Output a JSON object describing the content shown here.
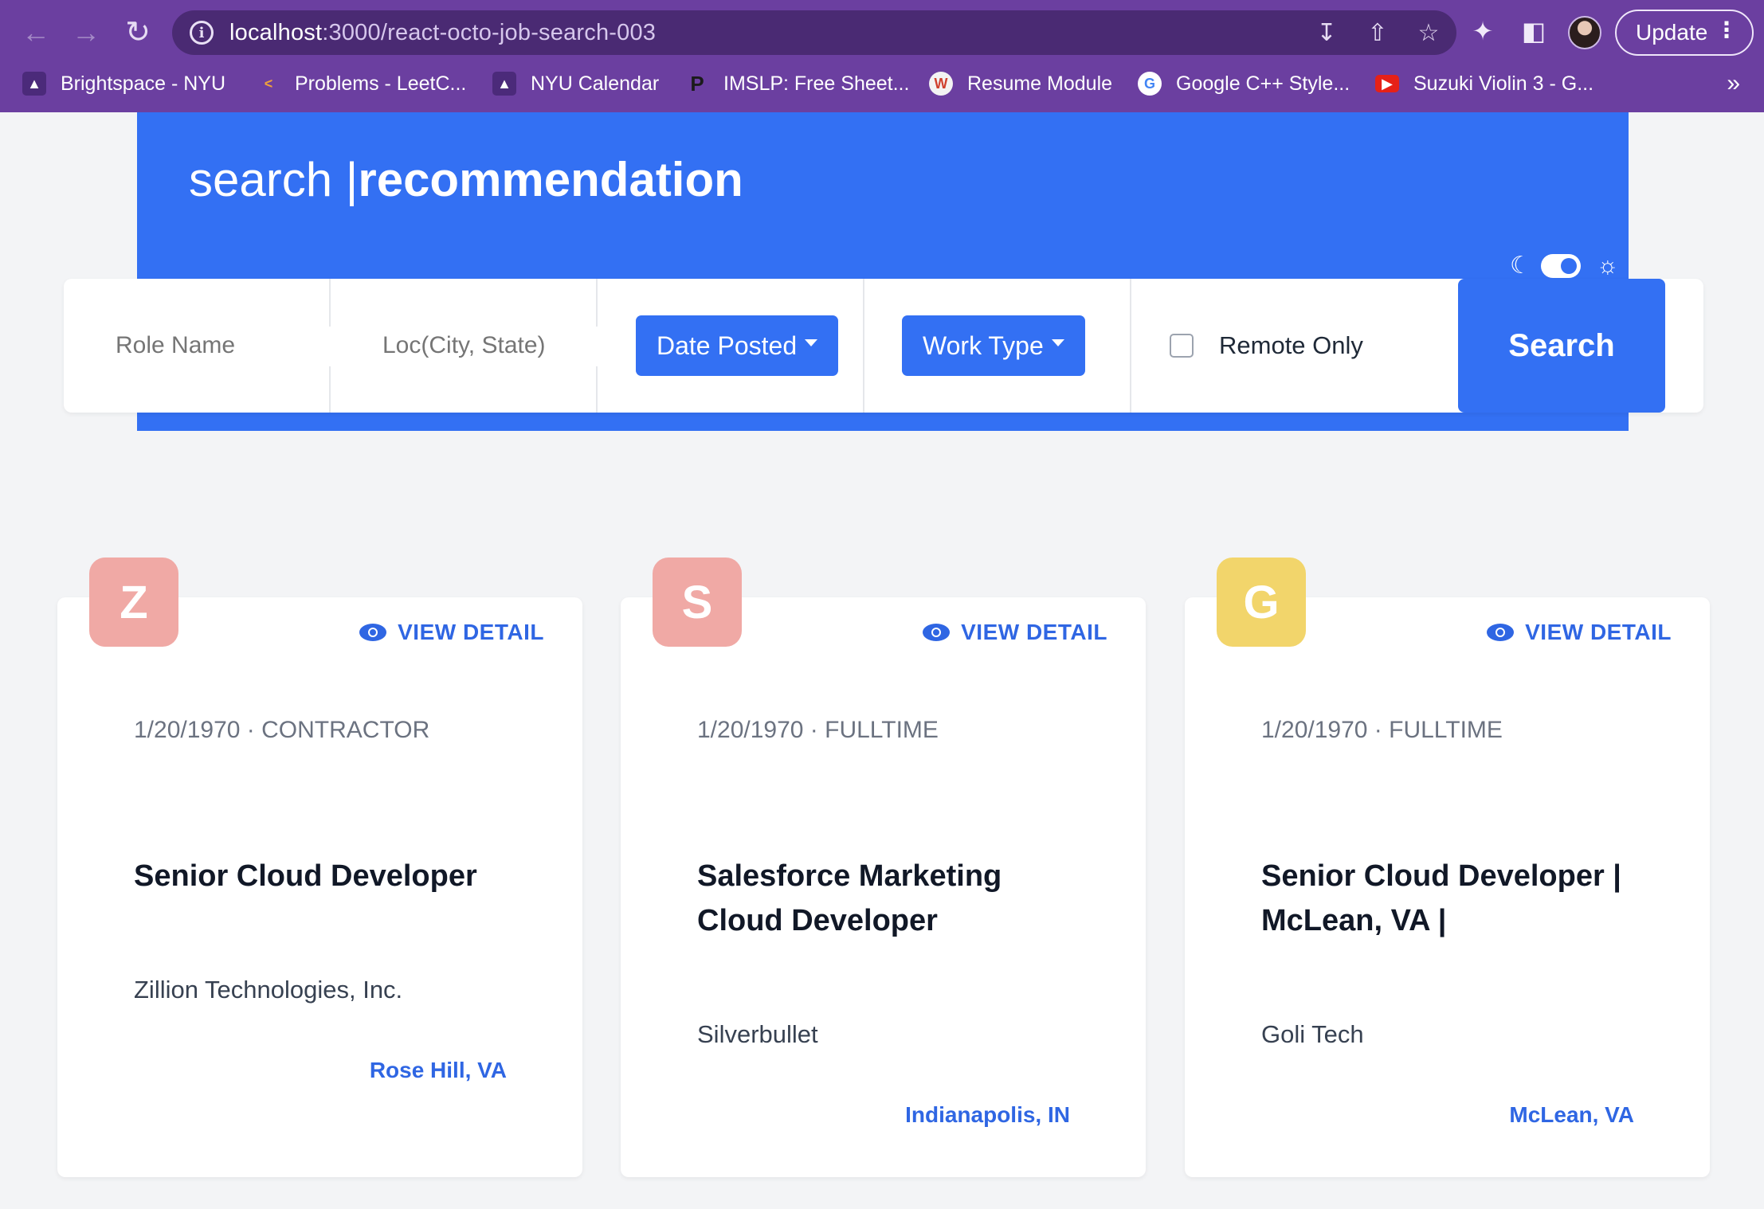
{
  "browser": {
    "url_host": "localhost",
    "url_path": ":3000/react-octo-job-search-003",
    "update_label": "Update",
    "bookmarks": [
      {
        "label": "Brightspace - NYU",
        "icon": "torch-icon"
      },
      {
        "label": "Problems - LeetC...",
        "icon": "leetcode-icon"
      },
      {
        "label": "NYU Calendar",
        "icon": "torch-icon"
      },
      {
        "label": "IMSLP: Free Sheet...",
        "icon": "imslp-icon"
      },
      {
        "label": "Resume Module",
        "icon": "resume-icon"
      },
      {
        "label": "Google C++ Style...",
        "icon": "google-icon"
      },
      {
        "label": "Suzuki Violin 3 - G...",
        "icon": "youtube-icon"
      }
    ],
    "more_label": "»"
  },
  "hero": {
    "title_light": "search |",
    "title_bold": "recommendation"
  },
  "search": {
    "role_placeholder": "Role Name",
    "location_placeholder": "Loc(City, State)",
    "date_posted_label": "Date Posted",
    "work_type_label": "Work Type",
    "remote_only_label": "Remote Only",
    "remote_only_checked": false,
    "search_label": "Search"
  },
  "theme": {
    "dark_icon": "moon-icon",
    "light_icon": "sun-icon",
    "toggle_on": true
  },
  "cards": [
    {
      "logo_letter": "Z",
      "logo_color": "#f0a9a5",
      "view_label": "VIEW DETAIL",
      "meta": "1/20/1970 · CONTRACTOR",
      "title": "Senior Cloud Developer",
      "company": "Zillion Technologies, Inc.",
      "location": "Rose Hill, VA"
    },
    {
      "logo_letter": "S",
      "logo_color": "#f0a9a5",
      "view_label": "VIEW DETAIL",
      "meta": "1/20/1970 · FULLTIME",
      "title": "Salesforce Marketing Cloud Developer",
      "company": "Silverbullet",
      "location": "Indianapolis, IN"
    },
    {
      "logo_letter": "G",
      "logo_color": "#f2d56b",
      "view_label": "VIEW DETAIL",
      "meta": "1/20/1970 · FULLTIME",
      "title": "Senior Cloud Developer | McLean, VA |",
      "company": "Goli Tech",
      "location": "McLean, VA"
    }
  ],
  "colors": {
    "accent": "#3370f3",
    "chrome": "#6b3fa0",
    "link": "#2f66e3"
  }
}
